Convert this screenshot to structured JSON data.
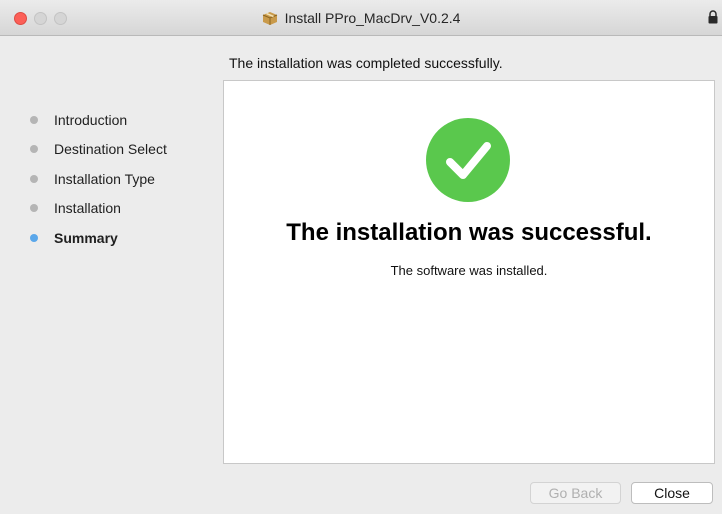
{
  "window": {
    "title": "Install PPro_MacDrv_V0.2.4",
    "icon": "package-icon",
    "lock_icon": "lock-icon"
  },
  "subtitle": "The installation was completed successfully.",
  "sidebar": {
    "items": [
      {
        "label": "Introduction",
        "active": false
      },
      {
        "label": "Destination Select",
        "active": false
      },
      {
        "label": "Installation Type",
        "active": false
      },
      {
        "label": "Installation",
        "active": false
      },
      {
        "label": "Summary",
        "active": true
      }
    ]
  },
  "main": {
    "icon": "checkmark-icon",
    "headline": "The installation was successful.",
    "detail": "The software was installed."
  },
  "buttons": {
    "go_back": "Go Back",
    "go_back_enabled": false,
    "close": "Close"
  },
  "colors": {
    "success_green": "#5ac84d",
    "active_step": "#5aa7ea",
    "inactive_step": "#b5b5b5",
    "close_light": "#fc5f57"
  }
}
